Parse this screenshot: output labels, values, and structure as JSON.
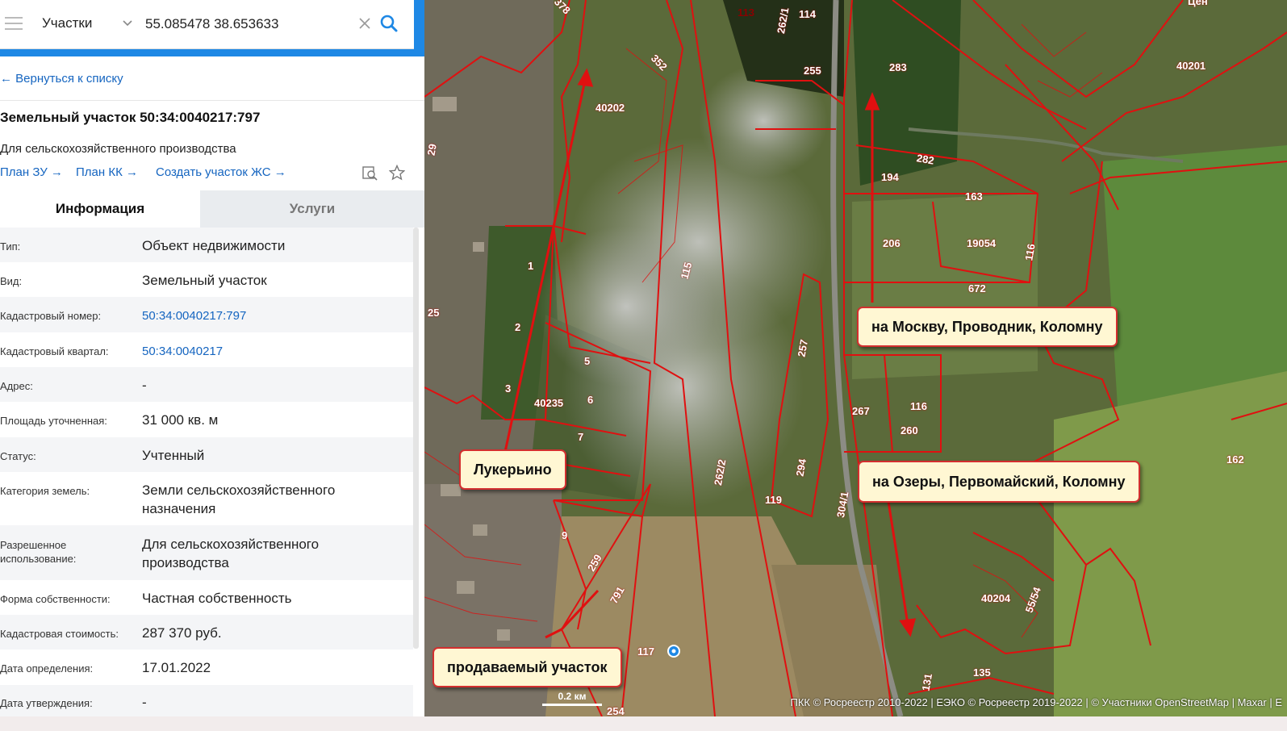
{
  "search": {
    "layer": "Участки",
    "query": "55.085478 38.653633"
  },
  "panel": {
    "back_link": "← Вернуться к списку",
    "title": "Земельный участок 50:34:0040217:797",
    "subtitle": "Для сельскохозяйственного производства",
    "links": [
      "План ЗУ →",
      "План КК →",
      "Создать участок ЖС →"
    ],
    "tabs": [
      "Информация",
      "Услуги"
    ],
    "rows": [
      {
        "label": "Тип:",
        "value": "Объект недвижимости"
      },
      {
        "label": "Вид:",
        "value": "Земельный участок"
      },
      {
        "label": "Кадастровый номер:",
        "value": "50:34:0040217:797"
      },
      {
        "label": "Кадастровый квартал:",
        "value": "50:34:0040217"
      },
      {
        "label": "Адрес:",
        "value": "-"
      },
      {
        "label": "Площадь уточненная:",
        "value": "31 000 кв. м"
      },
      {
        "label": "Статус:",
        "value": "Учтенный"
      },
      {
        "label": "Категория земель:",
        "value": "Земли сельскохозяйственного назначения"
      },
      {
        "label": "Разрешенное использование:",
        "value": "Для сельскохозяйственного производства"
      },
      {
        "label": "Форма собственности:",
        "value": "Частная собственность"
      },
      {
        "label": "Кадастровая стоимость:",
        "value": "287 370 руб."
      },
      {
        "label": "Дата определения:",
        "value": "17.01.2022"
      },
      {
        "label": "Дата утверждения:",
        "value": "-"
      }
    ]
  },
  "map": {
    "callouts": {
      "moscow": "на Москву, Проводник, Коломну",
      "ozery": "на Озеры, Первомайский, Коломну",
      "lukerino": "Лукерьино",
      "plot": "продаваемый участок"
    },
    "plot_numbers": [
      "113",
      "114",
      "262/1",
      "255",
      "283",
      "378",
      "352",
      "40202",
      "40201",
      "29",
      "282",
      "194",
      "163",
      "206",
      "19054",
      "116",
      "672",
      "115",
      "1",
      "2",
      "3",
      "5",
      "6",
      "7",
      "40235",
      "9",
      "25",
      "257",
      "267",
      "116",
      "260",
      "262/2",
      "294",
      "119",
      "304/1",
      "162",
      "259",
      "791",
      "40204",
      "55/54",
      "117",
      "131",
      "135",
      "254"
    ],
    "scale_label": "0.2 км",
    "attribution": "ПКК © Росреестр 2010-2022 | ЕЭКО © Росреестр 2019-2022 | © Участники OpenStreetMap | Maxar | E",
    "corner_text": "Цен"
  },
  "colors": {
    "accent": "#1e88e5",
    "link": "#1565c0",
    "boundary": "#e01010",
    "callout_bg": "#fff7d3"
  }
}
